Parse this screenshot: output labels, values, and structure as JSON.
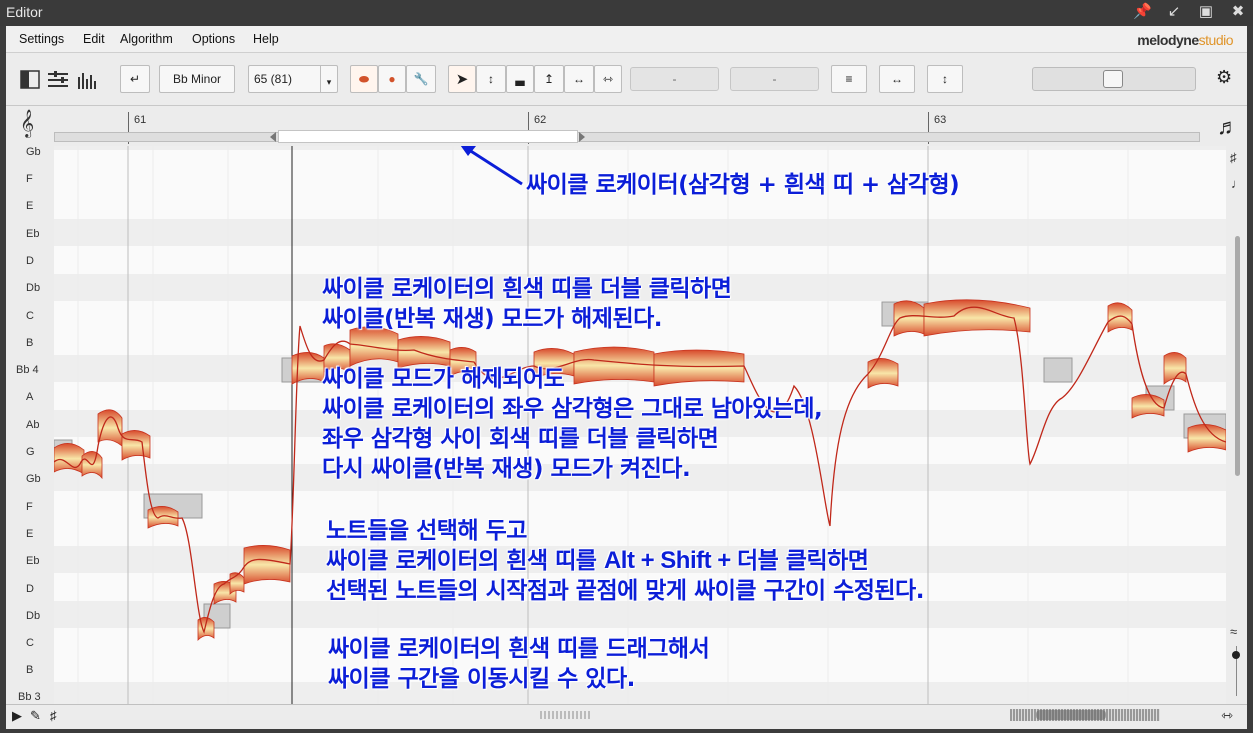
{
  "window": {
    "title": "Editor"
  },
  "menu": {
    "items": [
      "Settings",
      "Edit",
      "Algorithm",
      "Options",
      "Help"
    ],
    "brand_main": "melodyne",
    "brand_sub": "studio"
  },
  "toolbar": {
    "scale": "Bb Minor",
    "tempo": "65 (81)",
    "field1": "-",
    "field2": "-"
  },
  "ruler": {
    "bars": [
      "61",
      "62",
      "63"
    ]
  },
  "keyboard": {
    "pitches": [
      "Gb",
      "F",
      "E",
      "Eb",
      "D",
      "Db",
      "C",
      "B",
      "Bb 4",
      "A",
      "Ab",
      "G",
      "Gb",
      "F",
      "E",
      "Eb",
      "D",
      "Db",
      "C",
      "B",
      "Bb 3"
    ]
  },
  "annotations": {
    "arrow_label": "싸이클 로케이터(삼각형 + 흰색 띠 + 삼각형)",
    "p1": [
      "싸이클 로케이터의 흰색 띠를 더블 클릭하면",
      "싸이클(반복 재생) 모드가 해제된다."
    ],
    "p2": [
      "싸이클 모드가 해제되어도",
      "싸이클 로케이터의 좌우 삼각형은 그대로 남아있는데,",
      "좌우 삼각형 사이 회색 띠를 더블 클릭하면",
      "다시 싸이클(반복 재생) 모드가 켜진다."
    ],
    "p3_line1": "노트들을 선택해 두고",
    "p3_line2_pre": "싸이클 로케이터의 흰색 띠를 ",
    "p3_line2_keys": "Alt + Shift + ",
    "p3_line2_post": "더블 클릭하면",
    "p3_line3": "선택된 노트들의 시작점과 끝점에 맞게 싸이클 구간이 수정된다.",
    "p4": [
      "싸이클 로케이터의 흰색 띠를 드래그해서",
      "싸이클 구간을 이동시킬 수 있다."
    ]
  }
}
